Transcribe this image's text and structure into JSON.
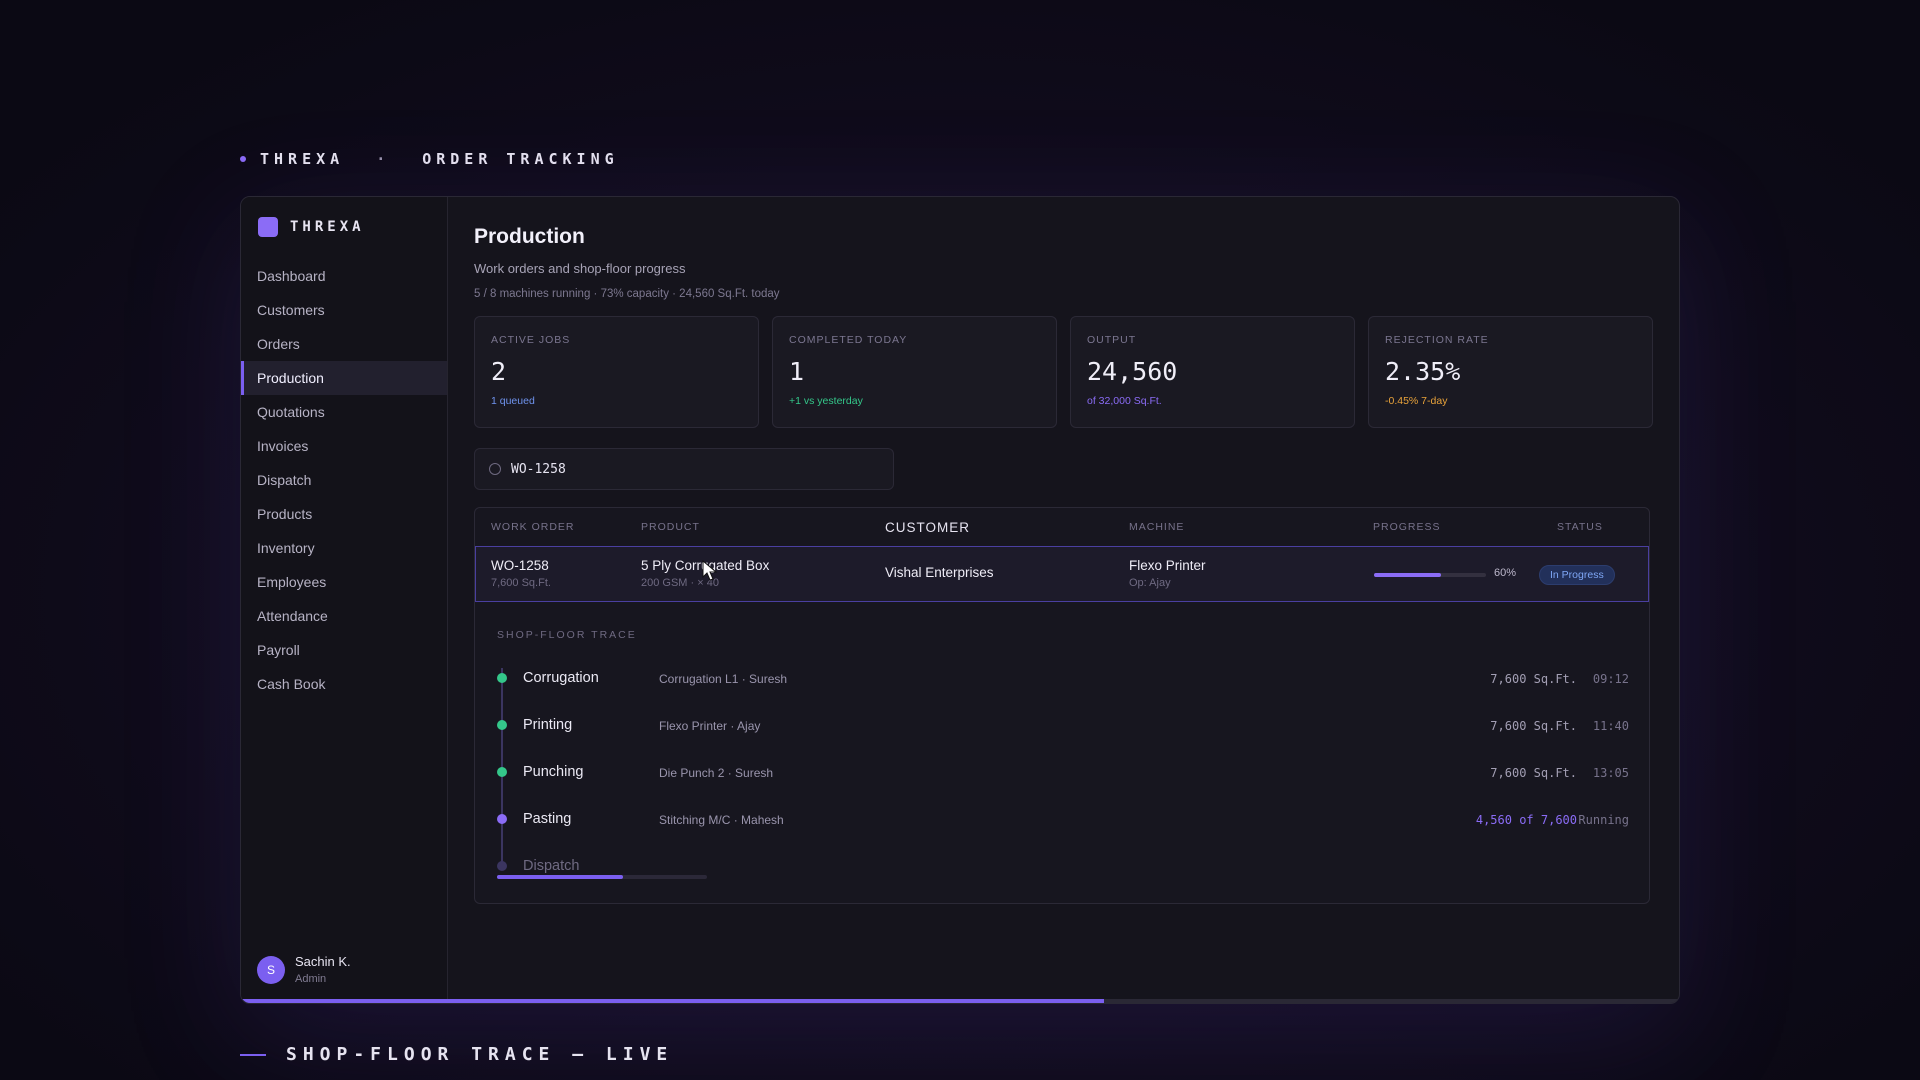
{
  "page_heading": {
    "brand": "THREXA",
    "separator": "·",
    "title": "ORDER TRACKING"
  },
  "footer_heading": "SHOP-FLOOR TRACE — LIVE",
  "sidebar": {
    "brand": "THREXA",
    "items": [
      {
        "label": "Dashboard"
      },
      {
        "label": "Customers"
      },
      {
        "label": "Orders"
      },
      {
        "label": "Production"
      },
      {
        "label": "Quotations"
      },
      {
        "label": "Invoices"
      },
      {
        "label": "Dispatch"
      },
      {
        "label": "Products"
      },
      {
        "label": "Inventory"
      },
      {
        "label": "Employees"
      },
      {
        "label": "Attendance"
      },
      {
        "label": "Payroll"
      },
      {
        "label": "Cash Book"
      }
    ],
    "active": "Production",
    "user": {
      "initial": "S",
      "name": "Sachin K.",
      "role": "Admin"
    }
  },
  "main": {
    "title": "Production",
    "subtitle": "Work orders and shop-floor progress",
    "meta": "5 / 8 machines running · 73% capacity · 24,560 Sq.Ft. today"
  },
  "stats": [
    {
      "label": "ACTIVE JOBS",
      "value": "2",
      "note": "1 queued",
      "note_color": "#6f93ee"
    },
    {
      "label": "COMPLETED TODAY",
      "value": "1",
      "note": "+1 vs yesterday",
      "note_color": "#34c78a"
    },
    {
      "label": "OUTPUT",
      "value": "24,560",
      "note": "of 32,000 Sq.Ft.",
      "note_color": "#8b6cf6"
    },
    {
      "label": "REJECTION RATE",
      "value": "2.35%",
      "note": "-0.45% 7-day",
      "note_color": "#e8a23a"
    }
  ],
  "search": {
    "value": "WO-1258"
  },
  "table": {
    "headers": {
      "work_order": "WORK ORDER",
      "product": "PRODUCT",
      "customer": "CUSTOMER",
      "machine": "MACHINE",
      "progress": "PROGRESS",
      "status": "STATUS"
    },
    "row": {
      "work_order": "WO-1258",
      "qty": "7,600 Sq.Ft.",
      "product": "5 Ply Corrugated Box",
      "product_spec": "200 GSM · × 40",
      "customer": "Vishal Enterprises",
      "machine": "Flexo Printer",
      "operator": "Op: Ajay",
      "progress": 0.6,
      "progress_label": "60%",
      "status": "In Progress"
    },
    "trace": {
      "label": "SHOP-FLOOR TRACE",
      "steps": [
        {
          "name": "Corrugation",
          "detail": "Corrugation L1 · Suresh",
          "qty": "7,600 Sq.Ft.",
          "time": "09:12",
          "state": "done"
        },
        {
          "name": "Printing",
          "detail": "Flexo Printer · Ajay",
          "qty": "7,600 Sq.Ft.",
          "time": "11:40",
          "state": "done"
        },
        {
          "name": "Punching",
          "detail": "Die Punch 2 · Suresh",
          "qty": "7,600 Sq.Ft.",
          "time": "13:05",
          "state": "done"
        },
        {
          "name": "Pasting",
          "detail": "Stitching M/C · Mahesh",
          "qty": "4,560 of 7,600",
          "time": "Running",
          "state": "running"
        },
        {
          "name": "Dispatch",
          "detail": "",
          "qty": "",
          "time": "",
          "state": "pending",
          "progress": 0.6
        }
      ]
    }
  },
  "app_progress": 0.6,
  "colors": {
    "accent": "#7b5ff0",
    "done": "#34c78a",
    "running": "#8b6cf6"
  }
}
